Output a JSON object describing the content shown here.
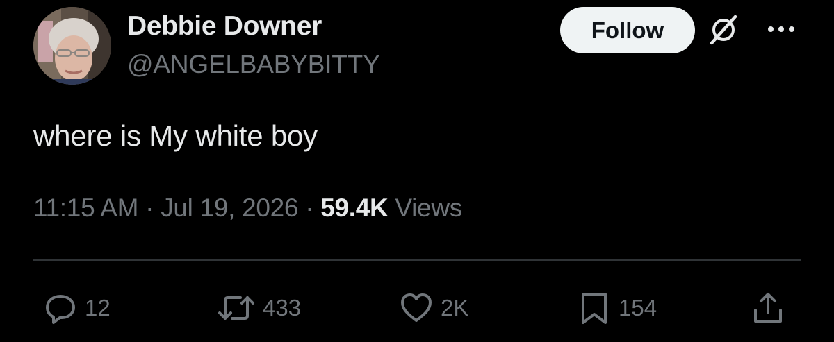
{
  "author": {
    "display_name": "Debbie Downer",
    "handle": "@ANGELBABYBITTY",
    "avatar": "profile-photo"
  },
  "header": {
    "follow_label": "Follow",
    "grok_icon": "grok-icon",
    "more_icon": "more-horizontal-icon"
  },
  "tweet": {
    "text": "where is My white boy"
  },
  "meta": {
    "time": "11:15 AM",
    "separator": "·",
    "date": "Jul 19, 2026",
    "views_count": "59.4K",
    "views_label": "Views"
  },
  "actions": {
    "replies": {
      "icon": "reply-icon",
      "count": "12"
    },
    "reposts": {
      "icon": "repost-icon",
      "count": "433"
    },
    "likes": {
      "icon": "heart-icon",
      "count": "2K"
    },
    "bookmarks": {
      "icon": "bookmark-icon",
      "count": "154"
    },
    "share": {
      "icon": "share-icon"
    }
  },
  "colors": {
    "background": "#000000",
    "primary_text": "#e7e9ea",
    "secondary_text": "#71767b",
    "divider": "#2f3336",
    "follow_button_bg": "#eff3f4"
  }
}
